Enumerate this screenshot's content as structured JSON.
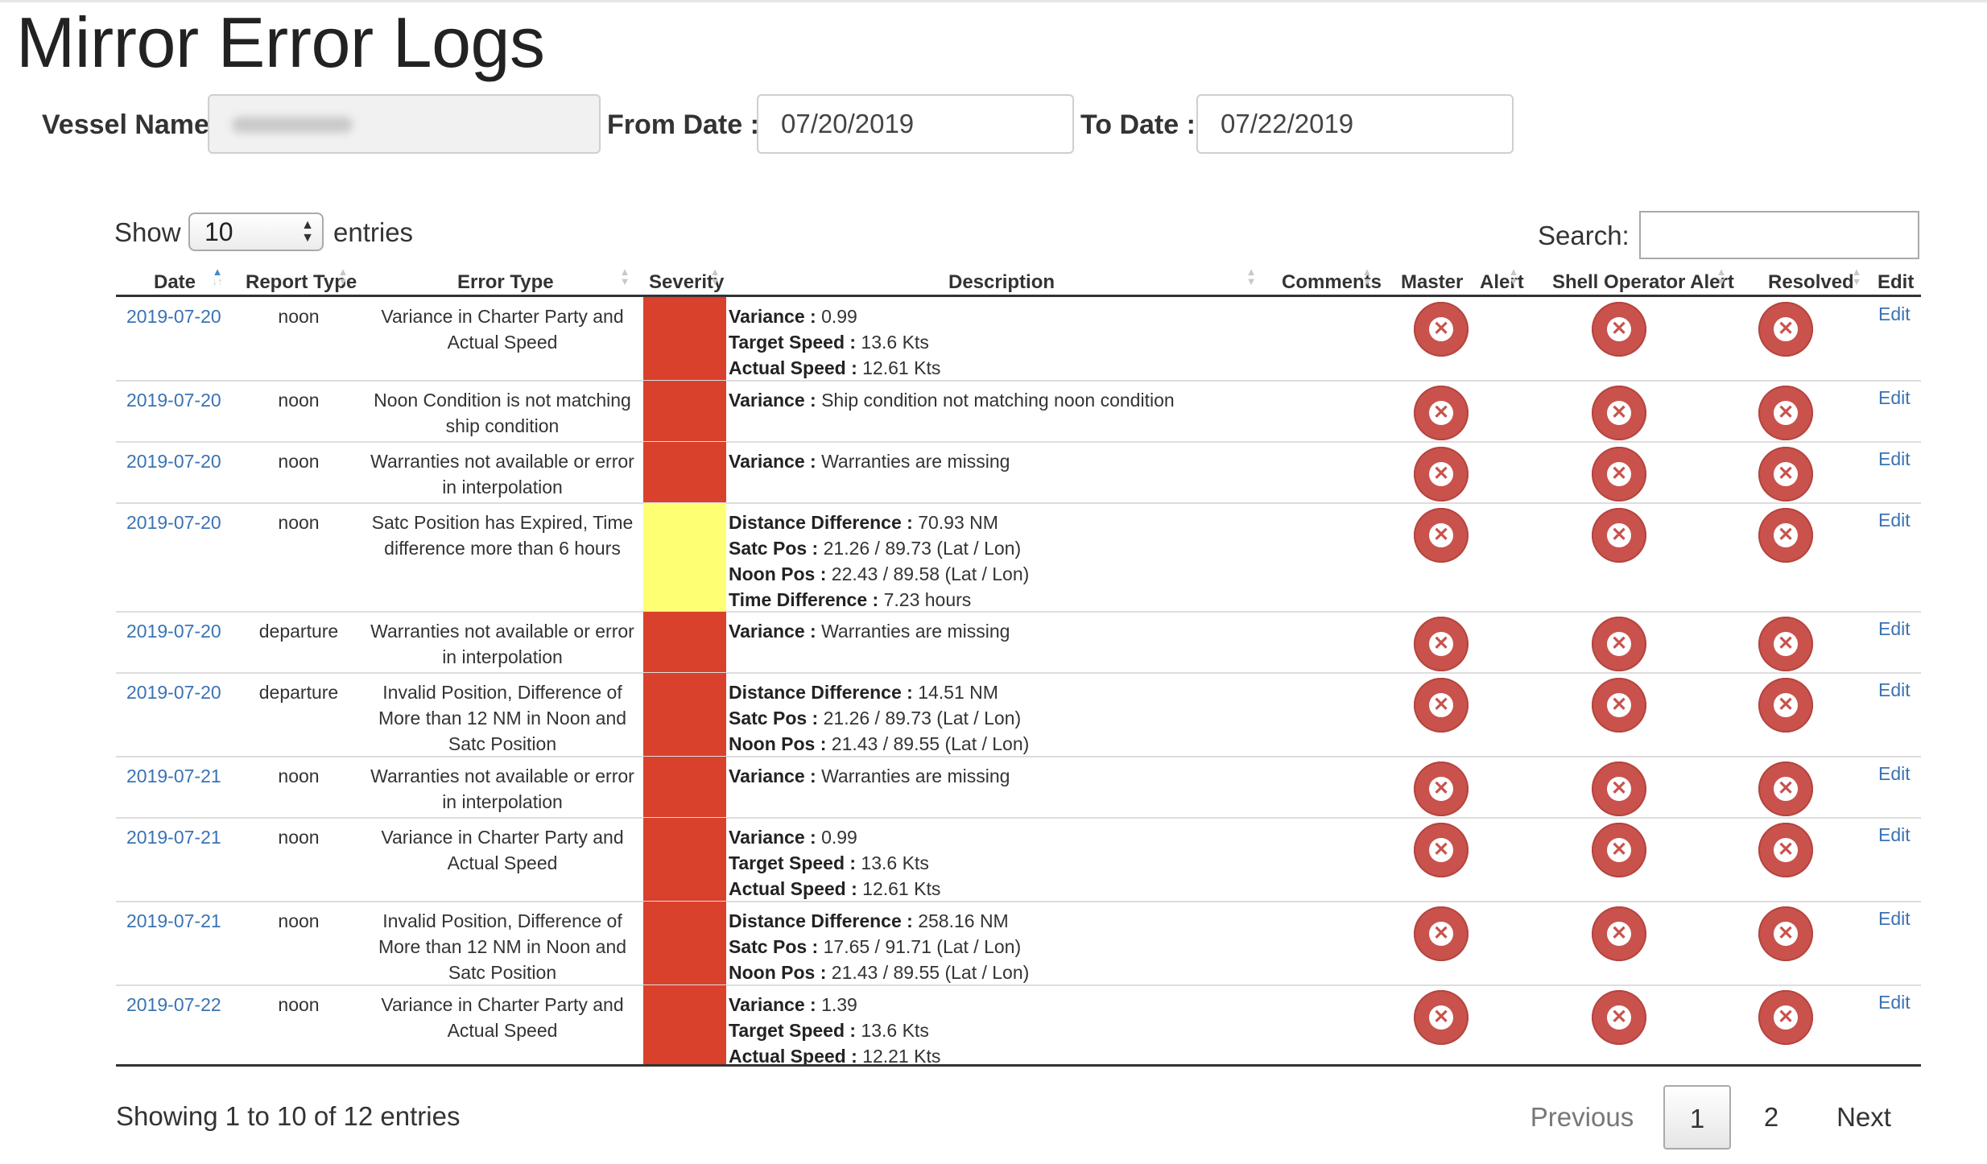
{
  "page": {
    "title": "Mirror Error Logs"
  },
  "filters": {
    "vessel_label": "Vessel Name",
    "from_label": "From Date :",
    "from_value": "07/20/2019",
    "to_label": "To Date :",
    "to_value": "07/22/2019"
  },
  "length": {
    "show": "Show",
    "value": "10",
    "entries": "entries"
  },
  "search": {
    "label": "Search:"
  },
  "columns": [
    "Date",
    "Report Type",
    "Error Type",
    "Severity",
    "Description",
    "Comments",
    "Master",
    "Alert",
    "Shell Operator Alert",
    "Resolved",
    "Edit"
  ],
  "severity_colors": {
    "high": "#d9412d",
    "medium": "#ffff73"
  },
  "rows": [
    {
      "date": "2019-07-20",
      "report_type": "noon",
      "error_type": [
        "Variance in Charter Party and",
        "Actual Speed"
      ],
      "severity": "high",
      "desc": [
        [
          "Variance :",
          " 0.99"
        ],
        [
          "Target Speed :",
          " 13.6 Kts"
        ],
        [
          "Actual Speed :",
          " 12.61 Kts"
        ]
      ],
      "edit": "Edit"
    },
    {
      "date": "2019-07-20",
      "report_type": "noon",
      "error_type": [
        "Noon Condition is not matching",
        "ship condition"
      ],
      "severity": "high",
      "desc": [
        [
          "Variance :",
          " Ship condition not matching noon condition"
        ]
      ],
      "edit": "Edit"
    },
    {
      "date": "2019-07-20",
      "report_type": "noon",
      "error_type": [
        "Warranties not available or error",
        "in interpolation"
      ],
      "severity": "high",
      "desc": [
        [
          "Variance :",
          " Warranties are missing"
        ]
      ],
      "edit": "Edit"
    },
    {
      "date": "2019-07-20",
      "report_type": "noon",
      "error_type": [
        "Satc Position has Expired, Time",
        "difference more than 6 hours"
      ],
      "severity": "medium",
      "desc": [
        [
          "Distance Difference :",
          " 70.93 NM"
        ],
        [
          "Satc Pos :",
          " 21.26 / 89.73 (Lat / Lon)"
        ],
        [
          "Noon Pos :",
          " 22.43 / 89.58 (Lat / Lon)"
        ],
        [
          "Time Difference :",
          " 7.23 hours"
        ]
      ],
      "edit": "Edit"
    },
    {
      "date": "2019-07-20",
      "report_type": "departure",
      "error_type": [
        "Warranties not available or error",
        "in interpolation"
      ],
      "severity": "high",
      "desc": [
        [
          "Variance :",
          " Warranties are missing"
        ]
      ],
      "edit": "Edit"
    },
    {
      "date": "2019-07-20",
      "report_type": "departure",
      "error_type": [
        "Invalid Position, Difference of",
        "More than 12 NM in Noon and",
        "Satc Position"
      ],
      "severity": "high",
      "desc": [
        [
          "Distance Difference :",
          " 14.51 NM"
        ],
        [
          "Satc Pos :",
          " 21.26 / 89.73 (Lat / Lon)"
        ],
        [
          "Noon Pos :",
          " 21.43 / 89.55 (Lat / Lon)"
        ]
      ],
      "edit": "Edit"
    },
    {
      "date": "2019-07-21",
      "report_type": "noon",
      "error_type": [
        "Warranties not available or error",
        "in interpolation"
      ],
      "severity": "high",
      "desc": [
        [
          "Variance :",
          " Warranties are missing"
        ]
      ],
      "edit": "Edit"
    },
    {
      "date": "2019-07-21",
      "report_type": "noon",
      "error_type": [
        "Variance in Charter Party and",
        "Actual Speed"
      ],
      "severity": "high",
      "desc": [
        [
          "Variance :",
          " 0.99"
        ],
        [
          "Target Speed :",
          " 13.6 Kts"
        ],
        [
          "Actual Speed :",
          " 12.61 Kts"
        ]
      ],
      "edit": "Edit"
    },
    {
      "date": "2019-07-21",
      "report_type": "noon",
      "error_type": [
        "Invalid Position, Difference of",
        "More than 12 NM in Noon and",
        "Satc Position"
      ],
      "severity": "high",
      "desc": [
        [
          "Distance Difference :",
          " 258.16 NM"
        ],
        [
          "Satc Pos :",
          " 17.65 / 91.71 (Lat / Lon)"
        ],
        [
          "Noon Pos :",
          " 21.43 / 89.55 (Lat / Lon)"
        ]
      ],
      "edit": "Edit"
    },
    {
      "date": "2019-07-22",
      "report_type": "noon",
      "error_type": [
        "Variance in Charter Party and",
        "Actual Speed"
      ],
      "severity": "high",
      "desc": [
        [
          "Variance :",
          " 1.39"
        ],
        [
          "Target Speed :",
          " 13.6 Kts"
        ],
        [
          "Actual Speed :",
          " 12.21 Kts"
        ]
      ],
      "edit": "Edit"
    }
  ],
  "footer": {
    "info": "Showing 1 to 10 of 12 entries"
  },
  "pagination": {
    "previous": "Previous",
    "pages": [
      "1",
      "2"
    ],
    "next": "Next"
  }
}
